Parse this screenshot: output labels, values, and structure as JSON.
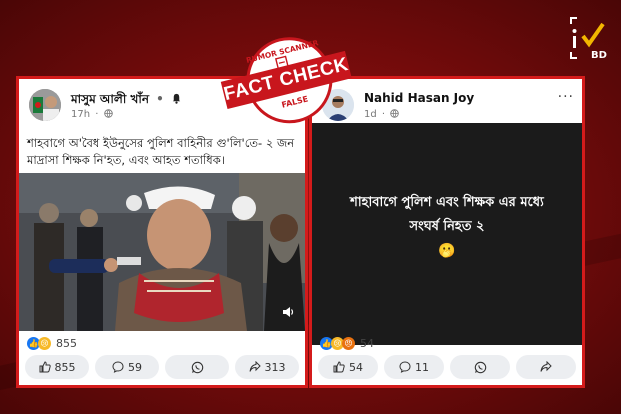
{
  "stamp": {
    "top_label": "RUMOR SCANNER",
    "main_label": "FACT CHECK",
    "verdict": "FALSE"
  },
  "left_post": {
    "author": "মাসুম আলী খাঁন",
    "separator": "•",
    "time": "17h",
    "more": "···",
    "text_line1": "শাহবাগে অ'বৈধ ইউনুসের পুলিশ বাহিনীর গু'লি'তে- ২ জন",
    "text_line2": "মাদ্রাসা শিক্ষক নি'হত, এবং আহত শতাধিক।",
    "reaction_count": "855",
    "actions": {
      "like": "855",
      "comment": "59",
      "share": "313"
    }
  },
  "right_post": {
    "author": "Nahid Hasan Joy",
    "time": "1d",
    "more": "···",
    "text_line1": "শাহাবাগে পুলিশ এবং শিক্ষক এর মধ্যে",
    "text_line2": "সংঘর্ষ নিহত ২",
    "emoji": "🫢",
    "reaction_count": "54",
    "actions": {
      "like": "54",
      "comment": "11"
    }
  },
  "colors": {
    "accent": "#d41b1b",
    "background": "#7a0c0c"
  }
}
